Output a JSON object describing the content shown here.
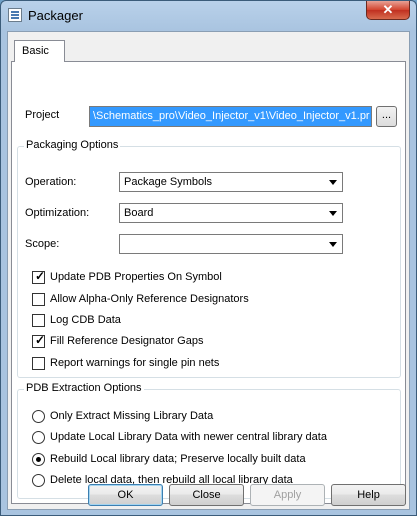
{
  "window": {
    "title": "Packager",
    "close_glyph": "✕"
  },
  "tabs": [
    {
      "label": "Basic"
    }
  ],
  "project": {
    "label": "Project",
    "value": "\\Schematics_pro\\Video_Injector_v1\\Video_Injector_v1.pr",
    "browse_label": "..."
  },
  "packaging_options": {
    "title": "Packaging Options",
    "operation": {
      "label": "Operation:",
      "value": "Package Symbols"
    },
    "optimization": {
      "label": "Optimization:",
      "value": "Board"
    },
    "scope": {
      "label": "Scope:",
      "value": ""
    },
    "checkboxes": [
      {
        "label": "Update PDB Properties On Symbol",
        "checked": true,
        "mark": "✓"
      },
      {
        "label": "Allow Alpha-Only Reference Designators",
        "checked": false,
        "mark": ""
      },
      {
        "label": "Log CDB Data",
        "checked": false,
        "mark": ""
      },
      {
        "label": "Fill Reference Designator Gaps",
        "checked": true,
        "mark": "✓"
      },
      {
        "label": "Report warnings for single pin nets",
        "checked": false,
        "mark": ""
      }
    ]
  },
  "pdb_extraction": {
    "title": "PDB Extraction Options",
    "radios": [
      {
        "label": "Only Extract Missing Library Data",
        "selected": false
      },
      {
        "label": "Update Local Library Data with newer central library data",
        "selected": false
      },
      {
        "label": "Rebuild Local library data; Preserve locally built data",
        "selected": true
      },
      {
        "label": "Delete local data, then rebuild all local library data",
        "selected": false
      }
    ]
  },
  "buttons": {
    "ok": "OK",
    "close": "Close",
    "apply": "Apply",
    "help": "Help"
  }
}
